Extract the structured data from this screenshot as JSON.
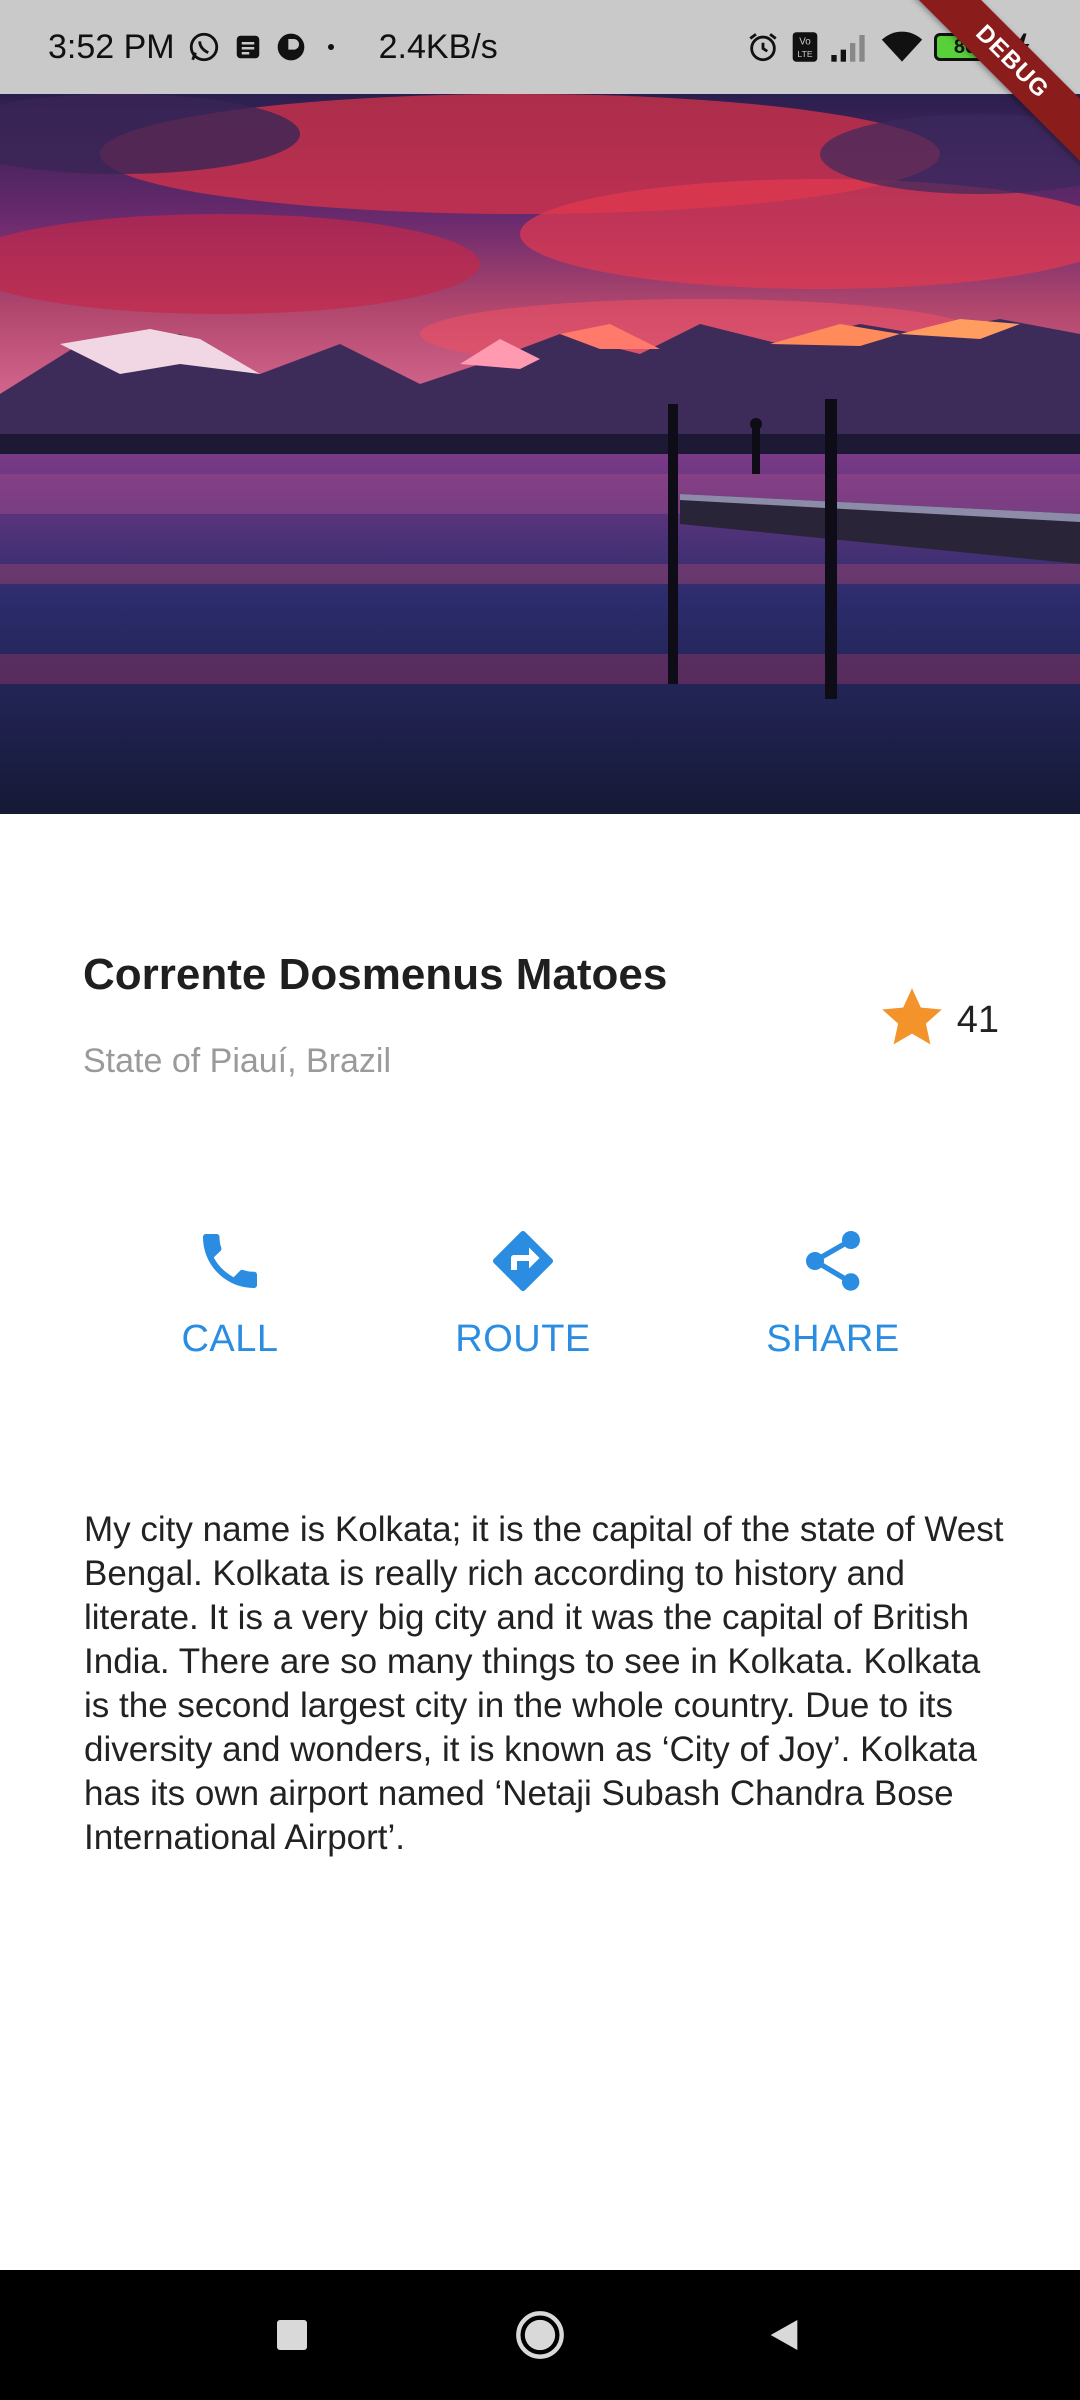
{
  "status_bar": {
    "time": "3:52 PM",
    "network_speed": "2.4KB/s",
    "battery_level": "80",
    "icons": [
      "whatsapp-icon",
      "message-icon",
      "app-icon",
      "alarm-icon",
      "volte-icon",
      "signal-icon",
      "wifi-icon",
      "battery-icon",
      "charging-icon"
    ]
  },
  "debug_banner": "DEBUG",
  "place": {
    "name": "Corrente Dosmenus Matoes",
    "location": "State of Piauí, Brazil",
    "rating_count": "41",
    "rating_icon": "star-icon"
  },
  "actions": [
    {
      "label": "CALL",
      "icon": "phone-icon"
    },
    {
      "label": "ROUTE",
      "icon": "directions-icon"
    },
    {
      "label": "SHARE",
      "icon": "share-icon"
    }
  ],
  "description": "My city name is Kolkata; it is the capital of the state of West Bengal. Kolkata is really rich according to history and literate. It is a very big city and it was the capital of British India. There are so many things to see in Kolkata. Kolkata is the second largest city in the whole country. Due to its diversity and wonders, it is known as ‘City of Joy’. Kolkata has its own airport named ‘Netaji Subash Chandra Bose International Airport’.",
  "nav_bar": {
    "buttons": [
      "recents-button",
      "home-button",
      "back-button"
    ]
  },
  "colors": {
    "accent": "#2b8de1",
    "star": "#f4932a",
    "status_bar_bg": "#c9c9c9",
    "nav_bar_bg": "#000000"
  }
}
